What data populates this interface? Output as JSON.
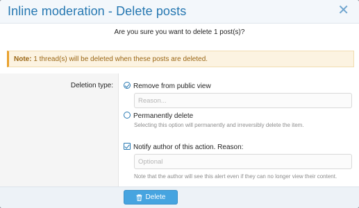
{
  "header": {
    "title": "Inline moderation - Delete posts",
    "close_glyph": "✕"
  },
  "confirm": {
    "text": "Are you sure you want to delete 1 post(s)?"
  },
  "notice": {
    "label": "Note:",
    "text": " 1 thread(s) will be deleted when these posts are deleted."
  },
  "form": {
    "deletion_type_label": "Deletion type:",
    "options": [
      {
        "label": "Remove from public view",
        "selected": true
      },
      {
        "label": "Permanently delete",
        "selected": false
      }
    ],
    "reason_placeholder": "Reason...",
    "reason_value": "",
    "permanent_hint": "Selecting this option will permanently and irreversibly delete the item.",
    "notify_label": "Notify author of this action. Reason:",
    "notify_checked": true,
    "notify_placeholder": "Optional",
    "notify_hint": "Note that the author will see this alert even if they can no longer view their content."
  },
  "footer": {
    "delete_label": "Delete"
  },
  "colors": {
    "title": "#2577b1",
    "button": "#46a4e0",
    "notice_bg": "#fcf3e1",
    "notice_text": "#9a6614"
  }
}
